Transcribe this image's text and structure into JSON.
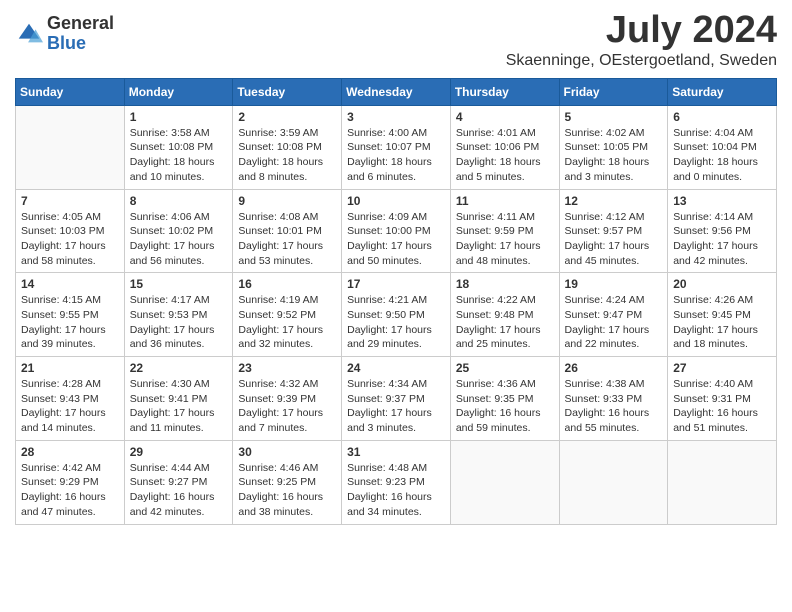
{
  "header": {
    "logo_general": "General",
    "logo_blue": "Blue",
    "month_title": "July 2024",
    "location": "Skaenninge, OEstergoetland, Sweden"
  },
  "days_of_week": [
    "Sunday",
    "Monday",
    "Tuesday",
    "Wednesday",
    "Thursday",
    "Friday",
    "Saturday"
  ],
  "weeks": [
    [
      {
        "day": "",
        "info": ""
      },
      {
        "day": "1",
        "info": "Sunrise: 3:58 AM\nSunset: 10:08 PM\nDaylight: 18 hours\nand 10 minutes."
      },
      {
        "day": "2",
        "info": "Sunrise: 3:59 AM\nSunset: 10:08 PM\nDaylight: 18 hours\nand 8 minutes."
      },
      {
        "day": "3",
        "info": "Sunrise: 4:00 AM\nSunset: 10:07 PM\nDaylight: 18 hours\nand 6 minutes."
      },
      {
        "day": "4",
        "info": "Sunrise: 4:01 AM\nSunset: 10:06 PM\nDaylight: 18 hours\nand 5 minutes."
      },
      {
        "day": "5",
        "info": "Sunrise: 4:02 AM\nSunset: 10:05 PM\nDaylight: 18 hours\nand 3 minutes."
      },
      {
        "day": "6",
        "info": "Sunrise: 4:04 AM\nSunset: 10:04 PM\nDaylight: 18 hours\nand 0 minutes."
      }
    ],
    [
      {
        "day": "7",
        "info": "Sunrise: 4:05 AM\nSunset: 10:03 PM\nDaylight: 17 hours\nand 58 minutes."
      },
      {
        "day": "8",
        "info": "Sunrise: 4:06 AM\nSunset: 10:02 PM\nDaylight: 17 hours\nand 56 minutes."
      },
      {
        "day": "9",
        "info": "Sunrise: 4:08 AM\nSunset: 10:01 PM\nDaylight: 17 hours\nand 53 minutes."
      },
      {
        "day": "10",
        "info": "Sunrise: 4:09 AM\nSunset: 10:00 PM\nDaylight: 17 hours\nand 50 minutes."
      },
      {
        "day": "11",
        "info": "Sunrise: 4:11 AM\nSunset: 9:59 PM\nDaylight: 17 hours\nand 48 minutes."
      },
      {
        "day": "12",
        "info": "Sunrise: 4:12 AM\nSunset: 9:57 PM\nDaylight: 17 hours\nand 45 minutes."
      },
      {
        "day": "13",
        "info": "Sunrise: 4:14 AM\nSunset: 9:56 PM\nDaylight: 17 hours\nand 42 minutes."
      }
    ],
    [
      {
        "day": "14",
        "info": "Sunrise: 4:15 AM\nSunset: 9:55 PM\nDaylight: 17 hours\nand 39 minutes."
      },
      {
        "day": "15",
        "info": "Sunrise: 4:17 AM\nSunset: 9:53 PM\nDaylight: 17 hours\nand 36 minutes."
      },
      {
        "day": "16",
        "info": "Sunrise: 4:19 AM\nSunset: 9:52 PM\nDaylight: 17 hours\nand 32 minutes."
      },
      {
        "day": "17",
        "info": "Sunrise: 4:21 AM\nSunset: 9:50 PM\nDaylight: 17 hours\nand 29 minutes."
      },
      {
        "day": "18",
        "info": "Sunrise: 4:22 AM\nSunset: 9:48 PM\nDaylight: 17 hours\nand 25 minutes."
      },
      {
        "day": "19",
        "info": "Sunrise: 4:24 AM\nSunset: 9:47 PM\nDaylight: 17 hours\nand 22 minutes."
      },
      {
        "day": "20",
        "info": "Sunrise: 4:26 AM\nSunset: 9:45 PM\nDaylight: 17 hours\nand 18 minutes."
      }
    ],
    [
      {
        "day": "21",
        "info": "Sunrise: 4:28 AM\nSunset: 9:43 PM\nDaylight: 17 hours\nand 14 minutes."
      },
      {
        "day": "22",
        "info": "Sunrise: 4:30 AM\nSunset: 9:41 PM\nDaylight: 17 hours\nand 11 minutes."
      },
      {
        "day": "23",
        "info": "Sunrise: 4:32 AM\nSunset: 9:39 PM\nDaylight: 17 hours\nand 7 minutes."
      },
      {
        "day": "24",
        "info": "Sunrise: 4:34 AM\nSunset: 9:37 PM\nDaylight: 17 hours\nand 3 minutes."
      },
      {
        "day": "25",
        "info": "Sunrise: 4:36 AM\nSunset: 9:35 PM\nDaylight: 16 hours\nand 59 minutes."
      },
      {
        "day": "26",
        "info": "Sunrise: 4:38 AM\nSunset: 9:33 PM\nDaylight: 16 hours\nand 55 minutes."
      },
      {
        "day": "27",
        "info": "Sunrise: 4:40 AM\nSunset: 9:31 PM\nDaylight: 16 hours\nand 51 minutes."
      }
    ],
    [
      {
        "day": "28",
        "info": "Sunrise: 4:42 AM\nSunset: 9:29 PM\nDaylight: 16 hours\nand 47 minutes."
      },
      {
        "day": "29",
        "info": "Sunrise: 4:44 AM\nSunset: 9:27 PM\nDaylight: 16 hours\nand 42 minutes."
      },
      {
        "day": "30",
        "info": "Sunrise: 4:46 AM\nSunset: 9:25 PM\nDaylight: 16 hours\nand 38 minutes."
      },
      {
        "day": "31",
        "info": "Sunrise: 4:48 AM\nSunset: 9:23 PM\nDaylight: 16 hours\nand 34 minutes."
      },
      {
        "day": "",
        "info": ""
      },
      {
        "day": "",
        "info": ""
      },
      {
        "day": "",
        "info": ""
      }
    ]
  ]
}
